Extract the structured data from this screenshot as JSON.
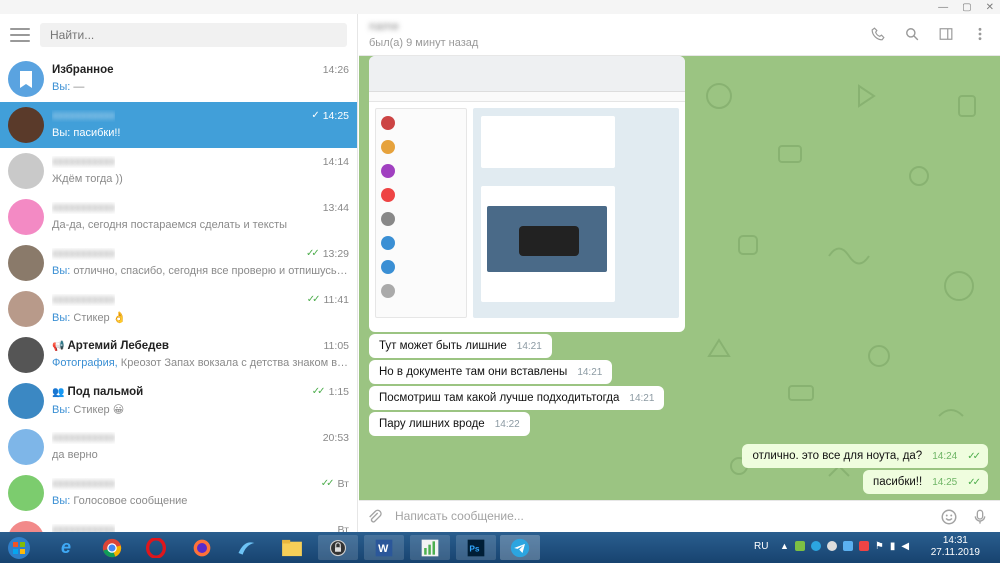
{
  "search": {
    "placeholder": "Найти..."
  },
  "chats": [
    {
      "name": "Избранное",
      "time": "14:26",
      "prefix": "Вы:",
      "preview": "—",
      "avatar_color": "#5aa3e0",
      "avatar_type": "bookmark"
    },
    {
      "name": "",
      "time": "14:25",
      "prefix": "Вы:",
      "preview": "пасибки!!",
      "avatar_color": "#5a3a2a",
      "checks": "✓",
      "active": true
    },
    {
      "name": "",
      "time": "14:14",
      "prefix": "",
      "preview": "Ждём тогда ))",
      "avatar_color": "#c9c9c9"
    },
    {
      "name": "",
      "time": "13:44",
      "prefix": "",
      "preview": "Да-да, сегодня постараемся сделать и тексты",
      "avatar_color": "#f38ac4"
    },
    {
      "name": "",
      "time": "13:29",
      "prefix": "Вы:",
      "preview": "отлично, спасибо, сегодня все проверю и отпишусь, и дене...",
      "avatar_color": "#8a7a6a",
      "checks": "✓✓"
    },
    {
      "name": "",
      "time": "11:41",
      "prefix": "Вы:",
      "preview": "Стикер 👌",
      "avatar_color": "#b89a8a",
      "checks": "✓✓"
    },
    {
      "name": "Артемий Лебедев",
      "time": "11:05",
      "prefix": "Фотография,",
      "preview": " Креозот  Запах вокзала с детства знаком всем. кто ...",
      "avatar_color": "#555",
      "channel": true
    },
    {
      "name": "Под пальмой",
      "time": "1:15",
      "prefix": "Вы:",
      "preview": "Стикер 😀",
      "avatar_color": "#3b88c3",
      "group": true,
      "checks": "✓✓"
    },
    {
      "name": "",
      "time": "20:53",
      "prefix": "",
      "preview": "да верно",
      "avatar_color": "#7eb6e8"
    },
    {
      "name": "",
      "time": "Вт",
      "prefix": "Вы:",
      "preview": "Голосовое сообщение",
      "avatar_color": "#7ccc6e",
      "checks": "✓✓"
    },
    {
      "name": "",
      "time": "Вт",
      "prefix": "",
      "preview": "",
      "avatar_color": "#f28a8a"
    }
  ],
  "peer": {
    "name": "",
    "status": "был(а) 9 минут назад"
  },
  "messages": [
    {
      "text": "Тут может быть лишние",
      "time": "14:21",
      "out": false
    },
    {
      "text": "Но в документе там они вставлены",
      "time": "14:21",
      "out": false
    },
    {
      "text": "Посмотриш там какой лучше подходитьтогда",
      "time": "14:21",
      "out": false
    },
    {
      "text": "Пару лишних вроде",
      "time": "14:22",
      "out": false
    },
    {
      "text": "отлично. это все для ноута, да?",
      "time": "14:24",
      "out": true
    },
    {
      "text": "пасибки!!",
      "time": "14:25",
      "out": true
    }
  ],
  "composer": {
    "placeholder": "Написать сообщение..."
  },
  "taskbar": {
    "lang": "RU",
    "time": "14:31",
    "date": "27.11.2019"
  },
  "colors": {
    "accent": "#419fd9",
    "chat_bg": "#9bc482",
    "out_bubble": "#effdde"
  }
}
